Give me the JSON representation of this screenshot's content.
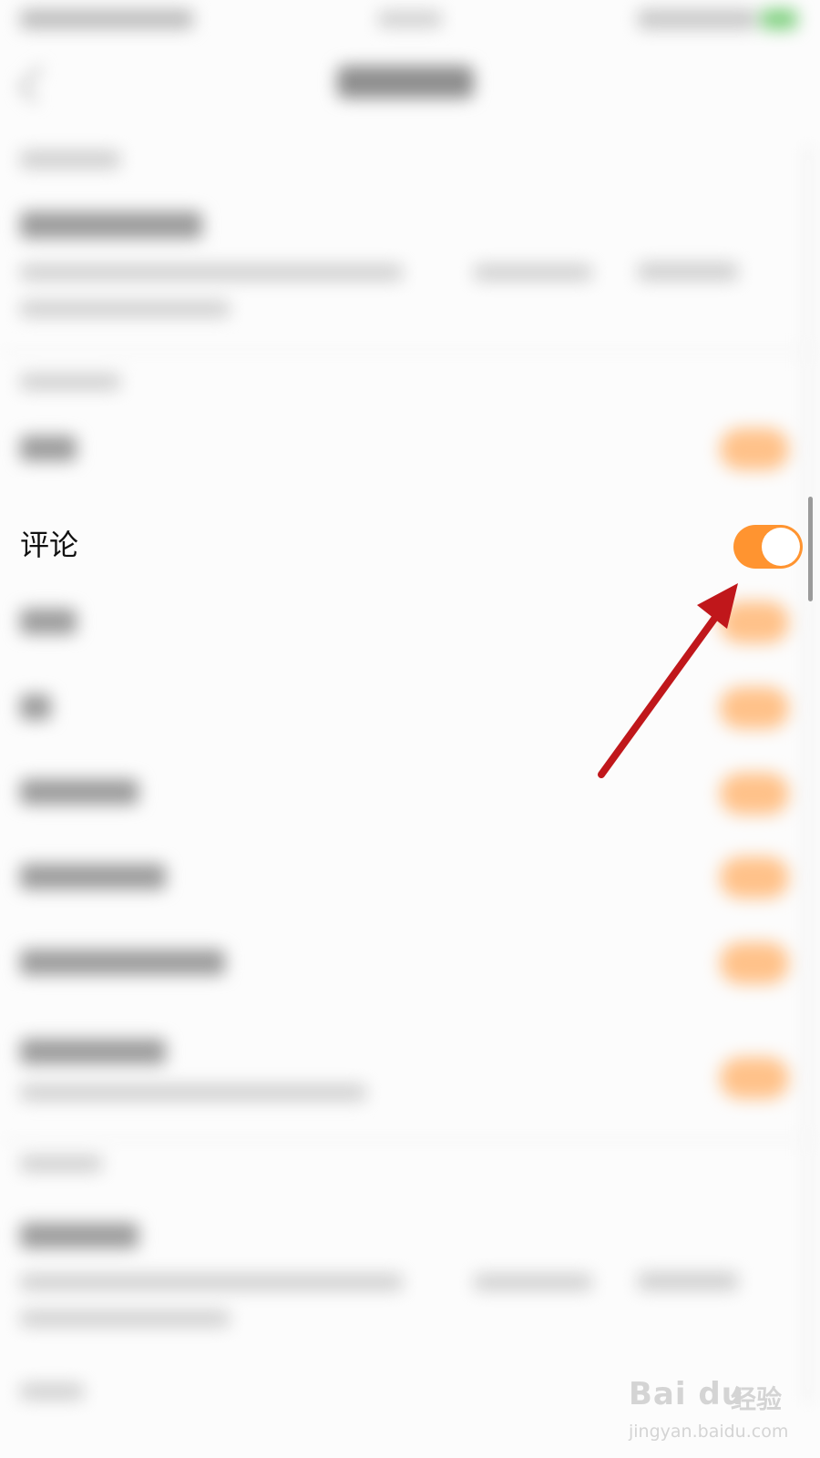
{
  "status_bar": {
    "style": "blurred"
  },
  "settings": {
    "focused_row": {
      "label": "评论",
      "toggle_on": true,
      "accent_color": "#ff9430"
    }
  },
  "watermark": {
    "logo": "Bai du",
    "brand": "经验",
    "url": "jingyan.baidu.com"
  },
  "annotation": {
    "arrow_color": "#c0171b"
  }
}
